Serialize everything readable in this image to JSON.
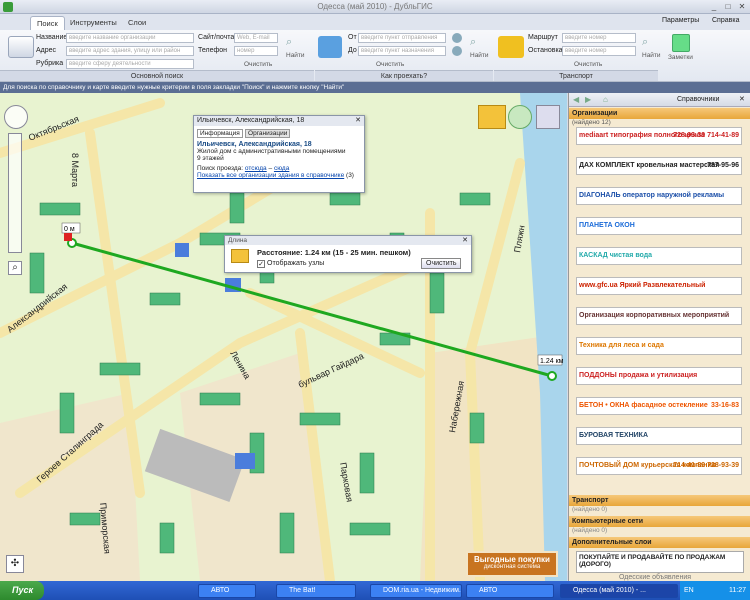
{
  "window": {
    "title": "Одесса (май 2010) - ДубльГИС"
  },
  "tabs": [
    "Поиск",
    "Инструменты",
    "Слои"
  ],
  "top_right": {
    "params": "Параметры",
    "help": "Справка"
  },
  "search": {
    "name_label": "Название",
    "name_ph": "введите название организации",
    "address_label": "Адрес",
    "address_ph": "введите адрес здания, улицу или район",
    "rubric_label": "Рубрика",
    "rubric_ph": "введите сферу деятельности",
    "site_label": "Сайт/почта",
    "site_ph": "Web, E-mail",
    "phone_label": "Телефон",
    "phone_ph": "номер",
    "find_label": "Найти",
    "clear_label": "Очистить"
  },
  "route": {
    "from_label": "От",
    "from_ph": "введите пункт отправления",
    "to_label": "До",
    "to_ph": "введите пункт назначения",
    "find_label": "Найти",
    "clear_label": "Очистить"
  },
  "transport": {
    "route_label": "Маршрут",
    "route_ph": "введите номер",
    "stop_label": "Остановка",
    "stop_ph": "введите номер",
    "find_label": "Найти",
    "clear_label": "Очистить",
    "notes": "Заметки"
  },
  "groups": [
    "Основной поиск",
    "Как проехать?",
    "Транспорт"
  ],
  "hint": "Для поиска по справочнику и карте введите нужные критерии в поля закладки \"Поиск\" и нажмите кнопку \"Найти\"",
  "info_popup": {
    "header": "Ильичевск, Александрийская, 18",
    "tab_info": "Информация",
    "tab_orgs": "Организации",
    "address": "Ильичевск, Александрийская, 18",
    "desc": "Жилой дом с административными помещениями",
    "floors": "9 этажей",
    "route_label": "Поиск проезда:",
    "route_from": "отсюда",
    "route_sep": "–",
    "route_to": "сюда",
    "show_all": "Показать все организации здания в справочнике",
    "show_all_count": "(3)"
  },
  "distance_popup": {
    "header": "Длина",
    "distance": "Расстояние: 1.24 км (15 - 25 мин. пешком)",
    "show_nodes": "Отображать узлы",
    "clear": "Очистить"
  },
  "map": {
    "start_label": "0 м",
    "end_label": "1.24 км",
    "streets": [
      "Октябрьская",
      "8 Марта",
      "Александрийская",
      "Героев Сталинграда",
      "Ленина",
      "бульвар Гайдара",
      "Парковая",
      "Набережная",
      "Приморская",
      "Пляжн"
    ],
    "promo_title": "Выгодные покупки",
    "promo_sub": "дисконтная система"
  },
  "sidebar": {
    "title": "Справочники",
    "orgs_header": "Организации",
    "orgs_sub": "(найдено 12)",
    "ads": [
      {
        "name": "mediaart типография полного цикла",
        "phone": "728-93-39 714-41-89"
      },
      {
        "name": "ДАХ КОМПЛЕКТ кровельная мастерская",
        "phone": "787-95-96"
      },
      {
        "name": "DIAГОНАЛЬ оператор наружной рекламы",
        "phone": ""
      },
      {
        "name": "ПЛАНЕТА ОКОН",
        "phone": ""
      },
      {
        "name": "КАСКАД чистая вода",
        "phone": ""
      },
      {
        "name": "www.gfc.ua Яркий Развлекательный",
        "phone": ""
      },
      {
        "name": "Организация корпоративных мероприятий",
        "phone": ""
      },
      {
        "name": "Техника для леса и сада",
        "phone": ""
      },
      {
        "name": "ПОДДОНЫ продажа и утилизация",
        "phone": ""
      },
      {
        "name": "БЕТОН • ОКНА фасадное остекление",
        "phone": "33-16-83"
      },
      {
        "name": "БУРОВАЯ ТЕХНИКА",
        "phone": ""
      },
      {
        "name": "ПОЧТОВЫЙ ДОМ курьерская компания",
        "phone": "714-41-89 728-93-39"
      }
    ],
    "transport_header": "Транспорт",
    "transport_sub": "(найдено 0)",
    "networks_header": "Компьютерные сети",
    "networks_sub": "(найдено 0)",
    "extra_header": "Дополнительные слои",
    "bottom_ad": "ПОКУПАЙТЕ И ПРОДАВАЙТЕ ПО ПРОДАЖАМ (ДОРОГО)",
    "watermark": "Одесские объявления"
  },
  "taskbar": {
    "start": "Пуск",
    "items": [
      "АВТО",
      "The Bat!",
      "DOM.ria.ua - Недвижим...",
      "АВТО",
      "Одесса (май 2010) - ..."
    ],
    "lang": "EN",
    "clock": "11:27"
  }
}
